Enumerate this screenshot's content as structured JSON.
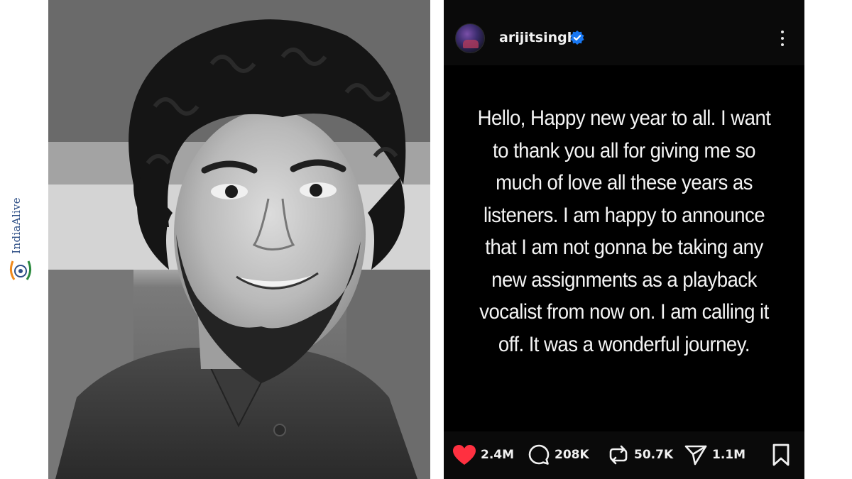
{
  "watermark": {
    "brand": "IndiaAlive",
    "logo_icon": "india-alive-emblem-icon"
  },
  "photo": {
    "subject": "portrait-photo",
    "style": "black-and-white"
  },
  "post": {
    "username": "arijitsingh",
    "verified_icon": "verified-badge-icon",
    "more_icon": "more-options-icon",
    "text": "Hello, Happy new year to all. I want to thank you all for giving me so much of love all these years as listeners. I am happy to announce that I am not gonna be taking any new assignments as a playback vocalist from now on. I am calling it off. It was a wonderful journey.",
    "actions": {
      "likes": "2.4M",
      "comments": "208K",
      "reposts": "50.7K",
      "shares": "1.1M"
    },
    "colors": {
      "like": "#ff3040",
      "verified": "#1877f2",
      "background": "#000000"
    }
  }
}
